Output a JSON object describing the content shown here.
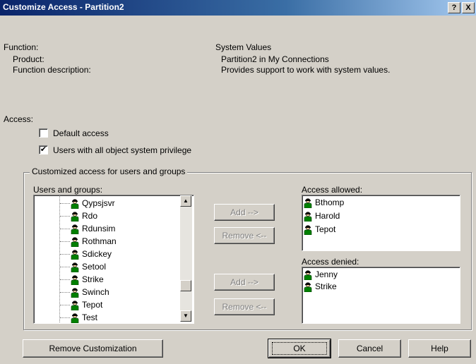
{
  "window": {
    "title": "Customize Access - Partition2",
    "help_btn": "?",
    "close_btn": "X"
  },
  "function": {
    "label": "Function:",
    "value": "System Values",
    "product_label": "Product:",
    "product_value": "Partition2 in My Connections",
    "description_label": "Function description:",
    "description_value": "Provides support to work with system values."
  },
  "access": {
    "label": "Access:",
    "default_access": {
      "label": "Default access",
      "checked": false
    },
    "all_object": {
      "label": "Users with all object system privilege",
      "checked": true
    }
  },
  "customized": {
    "group_label": "Customized access for users and groups",
    "users_label": "Users and groups:",
    "users": [
      "Qypsjsvr",
      "Rdo",
      "Rdunsim",
      "Rothman",
      "Sdickey",
      "Setool",
      "Strike",
      "Swinch",
      "Tepot",
      "Test"
    ],
    "allowed_label": "Access allowed:",
    "allowed": [
      "Bthomp",
      "Harold",
      "Tepot"
    ],
    "denied_label": "Access denied:",
    "denied": [
      "Jenny",
      "Strike"
    ],
    "add_allowed": "Add -->",
    "remove_allowed": "Remove <--",
    "add_denied": "Add -->",
    "remove_denied": "Remove <--"
  },
  "footer": {
    "remove_customization": "Remove Customization",
    "ok": "OK",
    "cancel": "Cancel",
    "help": "Help"
  },
  "icons": {
    "user": "user-icon",
    "scroll_up": "arrow-up-icon",
    "scroll_down": "arrow-down-icon"
  },
  "colors": {
    "title_start": "#0a246a",
    "title_end": "#a6caf0",
    "face": "#d4d0c8",
    "user_icon": "#008000"
  }
}
